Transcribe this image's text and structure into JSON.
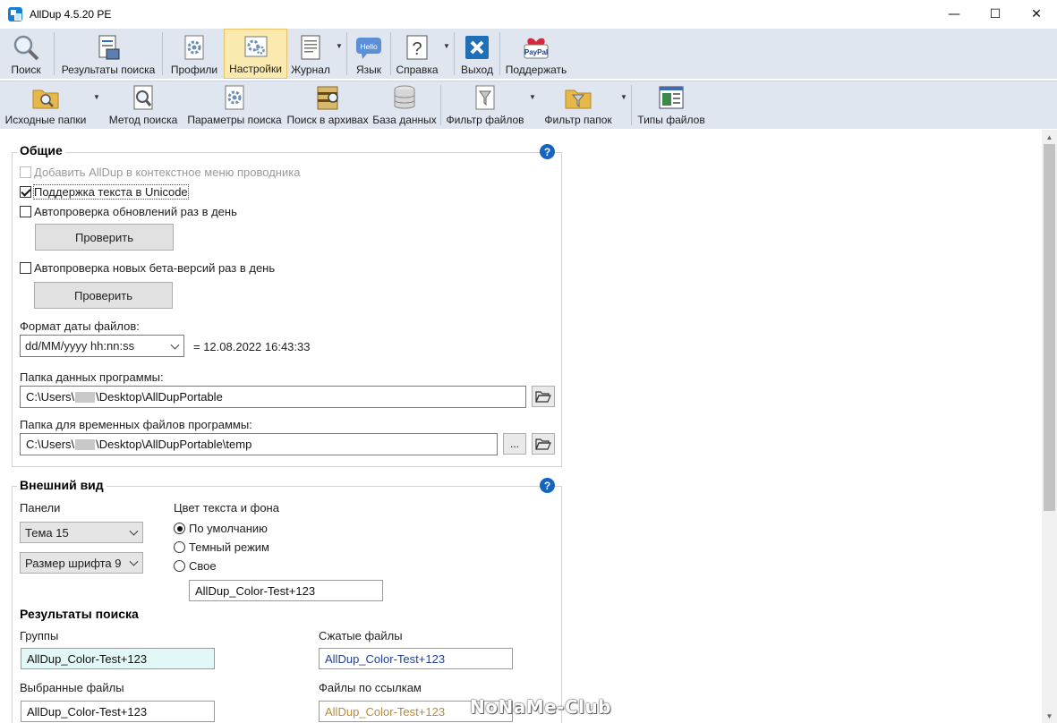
{
  "window": {
    "title": "AllDup 4.5.20 PE",
    "minimize": "—",
    "maximize": "☐",
    "close": "✕"
  },
  "toolbar1": {
    "search": "Поиск",
    "results": "Результаты поиска",
    "profiles": "Профили",
    "settings": "Настройки",
    "log": "Журнал",
    "language": "Язык",
    "language_icon_text": "Hello",
    "help": "Справка",
    "exit": "Выход",
    "support": "Поддержать",
    "paypal_text": "PayPal"
  },
  "toolbar2": {
    "source_folders": "Исходные папки",
    "search_method": "Метод поиска",
    "search_params": "Параметры поиска",
    "archive_search": "Поиск в архивах",
    "database": "База данных",
    "file_filter": "Фильтр файлов",
    "folder_filter": "Фильтр папок",
    "file_types": "Типы файлов"
  },
  "general": {
    "title": "Общие",
    "help": "?",
    "context_menu": "Добавить AllDup в контекстное меню проводника",
    "unicode": "Поддержка текста в Unicode",
    "auto_update": "Автопроверка обновлений раз в день",
    "check_btn1": "Проверить",
    "auto_beta": "Автопроверка новых бета-версий раз в день",
    "check_btn2": "Проверить",
    "date_format_label": "Формат даты файлов:",
    "date_format_value": "dd/MM/yyyy hh:nn:ss",
    "date_preview": "= 12.08.2022 16:43:33",
    "data_folder_label": "Папка данных программы:",
    "data_folder_prefix": "C:\\Users\\",
    "data_folder_suffix": "\\Desktop\\AllDupPortable",
    "temp_folder_label": "Папка для временных файлов программы:",
    "temp_folder_prefix": "C:\\Users\\",
    "temp_folder_suffix": "\\Desktop\\AllDupPortable\\temp",
    "ellipsis": "..."
  },
  "appearance": {
    "title": "Внешний вид",
    "help": "?",
    "panels_label": "Панели",
    "theme": "Тема 15",
    "font_size": "Размер шрифта 9",
    "color_label": "Цвет текста и фона",
    "radio_default": "По умолчанию",
    "radio_dark": "Темный режим",
    "radio_custom": "Свое",
    "custom_sample": "AllDup_Color-Test+123",
    "results_title": "Результаты поиска",
    "groups_label": "Группы",
    "groups_sample": "AllDup_Color-Test+123",
    "compressed_label": "Сжатые файлы",
    "compressed_sample": "AllDup_Color-Test+123",
    "selected_label": "Выбранные файлы",
    "selected_sample": "AllDup_Color-Test+123",
    "linked_label": "Файлы по ссылкам",
    "linked_sample": "AllDup_Color-Test+123"
  },
  "colors": {
    "groups_bg": "#e2f7f7",
    "compressed_text": "#1f3f9a",
    "linked_text": "#b88b35",
    "toolbar_bg": "#dfe6ef",
    "active_bg": "#fbeab0"
  },
  "watermark": "NoNaMe-Club"
}
